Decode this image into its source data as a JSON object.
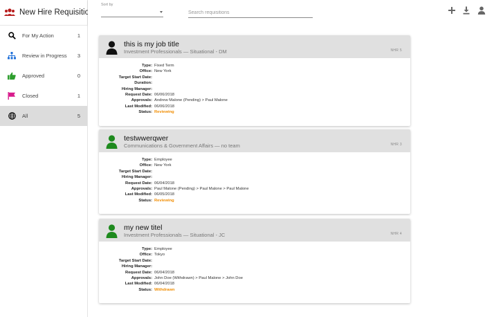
{
  "app": {
    "title": "New Hire Requisitions"
  },
  "sidebar": {
    "items": [
      {
        "label": "For My Action",
        "count": "1",
        "icon": "search-icon",
        "active": false
      },
      {
        "label": "Review in Progress",
        "count": "3",
        "icon": "org-chart-icon",
        "active": false
      },
      {
        "label": "Approved",
        "count": "0",
        "icon": "thumbs-up-icon",
        "active": false
      },
      {
        "label": "Closed",
        "count": "1",
        "icon": "flag-icon",
        "active": false
      },
      {
        "label": "All",
        "count": "5",
        "icon": "globe-icon",
        "active": true
      }
    ]
  },
  "topbar": {
    "sort_label": "Sort by",
    "sort_value": "",
    "search_placeholder": "Search requisitions",
    "icons": [
      "add-icon",
      "download-icon",
      "account-icon"
    ]
  },
  "field_labels": {
    "type": "Type:",
    "office": "Office:",
    "target_start": "Target Start Date:",
    "duration": "Duration:",
    "hiring_manager": "Hiring Manager:",
    "request_date": "Request Date:",
    "approvals": "Approvals:",
    "last_modified": "Last Modified:",
    "status": "Status:"
  },
  "colors": {
    "avatar_black": "#111111",
    "avatar_green": "#1e8a1e",
    "status_orange": "#f08c00",
    "header_gray": "#e0e0e0"
  },
  "cards": [
    {
      "title": "this is my job title",
      "subtitle": "Investment Professionals — Situational - DM",
      "number": "NHR 5",
      "avatar_color": "black",
      "type": "Fixed Term",
      "office": "New York",
      "target_start": "",
      "duration": "",
      "hiring_manager": "",
      "request_date": "06/06/2018",
      "approvals": "Andrew Malone (Pending) > Paul Malone",
      "last_modified": "06/06/2018",
      "status": "Reviewing"
    },
    {
      "title": "testwwerqwer",
      "subtitle": "Communications & Government Affairs — no team",
      "number": "NHR 3",
      "avatar_color": "green",
      "type": "Employee",
      "office": "New York",
      "target_start": "",
      "hiring_manager": "",
      "request_date": "06/04/2018",
      "approvals": "Paul Malone (Pending) > Paul Malone > Paul Malone",
      "last_modified": "06/05/2018",
      "status": "Reviewing"
    },
    {
      "title": "my new titel",
      "subtitle": "Investment Professionals — Situational - JC",
      "number": "NHR 4",
      "avatar_color": "green",
      "type": "Employee",
      "office": "Tokyo",
      "target_start": "",
      "hiring_manager": "",
      "request_date": "06/04/2018",
      "approvals": "John Doe (Withdrawn) > Paul Malone > John Doe",
      "last_modified": "06/04/2018",
      "status": "Withdrawn"
    }
  ]
}
